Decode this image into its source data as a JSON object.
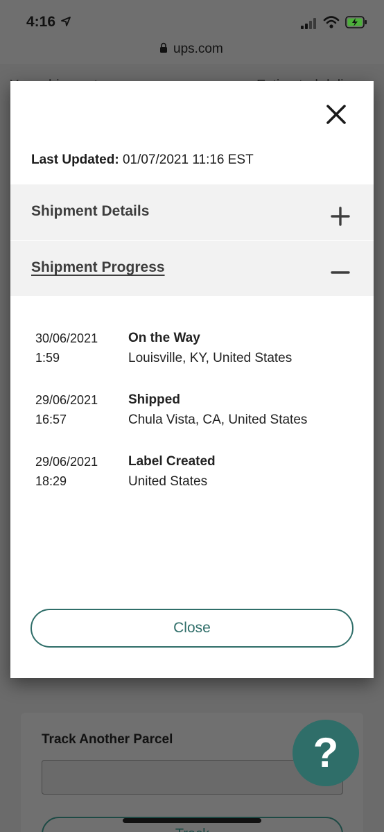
{
  "status_bar": {
    "time": "4:16"
  },
  "url_bar": {
    "domain": "ups.com"
  },
  "background": {
    "header_left": "Your shipment",
    "header_right": "Estimated deliv",
    "track_title": "Track Another Parcel",
    "track_button": "Track",
    "help_label": "?"
  },
  "modal": {
    "last_updated_label": "Last Updated:",
    "last_updated_value": "01/07/2021 11:16 EST",
    "sections": {
      "details": {
        "label": "Shipment Details",
        "icon": "plus-icon"
      },
      "progress": {
        "label": "Shipment Progress",
        "icon": "minus-icon"
      }
    },
    "events": [
      {
        "date": "30/06/2021",
        "time": "1:59",
        "status": "On the Way",
        "location": "Louisville, KY, United States"
      },
      {
        "date": "29/06/2021",
        "time": "16:57",
        "status": "Shipped",
        "location": "Chula Vista, CA, United States"
      },
      {
        "date": "29/06/2021",
        "time": "18:29",
        "status": "Label Created",
        "location": "United States"
      }
    ],
    "close_button": "Close"
  },
  "colors": {
    "accent": "#2f6e69",
    "section_bg": "#f2f2f2",
    "overlay": "#6e6e6e"
  }
}
